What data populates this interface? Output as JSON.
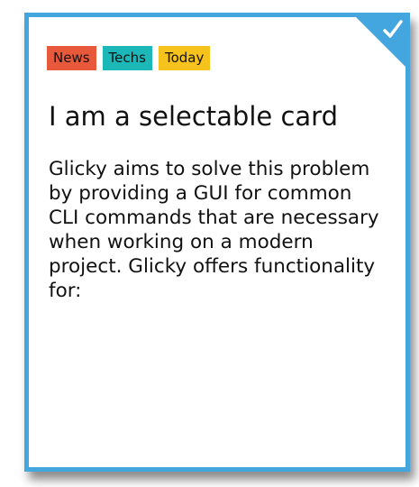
{
  "card": {
    "selected": true,
    "check_icon": "checkmark-icon",
    "accent_color": "#44a6df",
    "tags": [
      {
        "label": "News",
        "color": "#e8583a"
      },
      {
        "label": "Techs",
        "color": "#1cb8b8"
      },
      {
        "label": "Today",
        "color": "#f6c21c"
      }
    ],
    "title": "I am a selectable card",
    "body": "Glicky aims to solve this problem by providing a GUI for common CLI commands that are necessary when working on a modern project. Glicky offers functionality for:"
  }
}
